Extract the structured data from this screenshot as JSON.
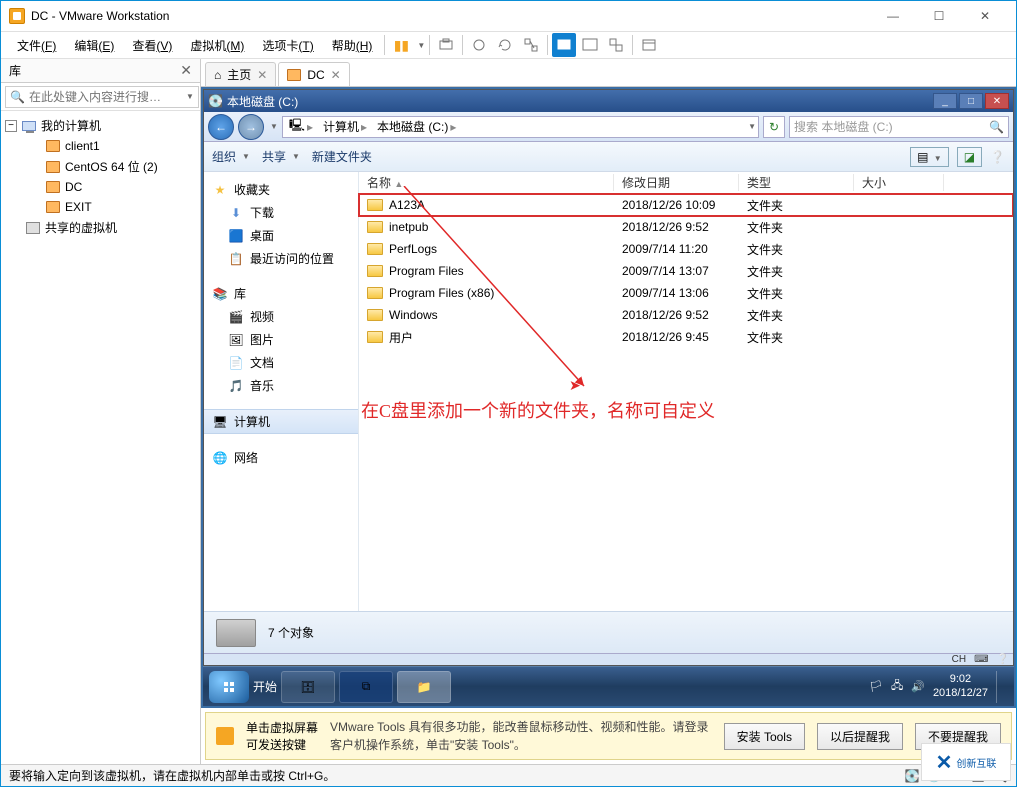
{
  "titlebar": {
    "title": "DC - VMware Workstation"
  },
  "menubar": {
    "file": "文件",
    "file_k": "(F)",
    "edit": "编辑",
    "edit_k": "(E)",
    "view": "查看",
    "view_k": "(V)",
    "vm": "虚拟机",
    "vm_k": "(M)",
    "tabs": "选项卡",
    "tabs_k": "(T)",
    "help": "帮助",
    "help_k": "(H)"
  },
  "library": {
    "title": "库",
    "search_placeholder": "在此处键入内容进行搜…",
    "root": "我的计算机",
    "items": [
      "client1",
      "CentOS 64 位 (2)",
      "DC",
      "EXIT"
    ],
    "shared": "共享的虚拟机"
  },
  "tabs": {
    "home": "主页",
    "dc": "DC"
  },
  "win7": {
    "title": "本地磁盘 (C:)",
    "breadcrumb": {
      "computer": "计算机",
      "drive": "本地磁盘 (C:)"
    },
    "search_placeholder": "搜索 本地磁盘 (C:)",
    "toolbar": {
      "organize": "组织",
      "share": "共享",
      "newfolder": "新建文件夹"
    },
    "columns": {
      "name": "名称",
      "date": "修改日期",
      "type": "类型",
      "size": "大小"
    },
    "sidebar": {
      "favorites": "收藏夹",
      "downloads": "下载",
      "desktop": "桌面",
      "recent": "最近访问的位置",
      "libraries": "库",
      "videos": "视频",
      "pictures": "图片",
      "documents": "文档",
      "music": "音乐",
      "computer": "计算机",
      "network": "网络"
    },
    "files": [
      {
        "name": "A123A",
        "date": "2018/12/26 10:09",
        "type": "文件夹",
        "highlight": true
      },
      {
        "name": "inetpub",
        "date": "2018/12/26 9:52",
        "type": "文件夹"
      },
      {
        "name": "PerfLogs",
        "date": "2009/7/14 11:20",
        "type": "文件夹"
      },
      {
        "name": "Program Files",
        "date": "2009/7/14 13:07",
        "type": "文件夹"
      },
      {
        "name": "Program Files (x86)",
        "date": "2009/7/14 13:06",
        "type": "文件夹"
      },
      {
        "name": "Windows",
        "date": "2018/12/26 9:52",
        "type": "文件夹"
      },
      {
        "name": "用户",
        "date": "2018/12/26 9:45",
        "type": "文件夹"
      }
    ],
    "annotation": "在C盘里添加一个新的文件夹，名称可自定义",
    "status_count": "7 个对象",
    "tray_lang": "CH",
    "taskbar": {
      "start": "开始",
      "time": "9:02",
      "date": "2018/12/27"
    }
  },
  "hint": {
    "line1": "单击虚拟屏幕",
    "line2": "可发送按键",
    "msg": "VMware Tools 具有很多功能，能改善鼠标移动性、视频和性能。请登录客户机操作系统，单击\"安装 Tools\"。",
    "install": "安装 Tools",
    "later": "以后提醒我",
    "never": "不要提醒我"
  },
  "statusbar": {
    "msg": "要将输入定向到该虚拟机，请在虚拟机内部单击或按 Ctrl+G。"
  }
}
